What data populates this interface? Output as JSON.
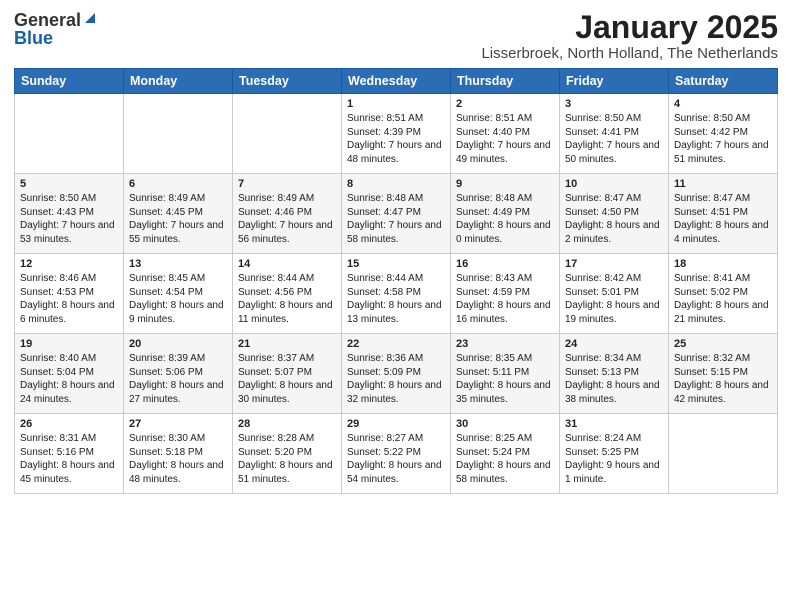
{
  "logo": {
    "general": "General",
    "blue": "Blue"
  },
  "header": {
    "month": "January 2025",
    "location": "Lisserbroek, North Holland, The Netherlands"
  },
  "weekdays": [
    "Sunday",
    "Monday",
    "Tuesday",
    "Wednesday",
    "Thursday",
    "Friday",
    "Saturday"
  ],
  "weeks": [
    [
      {
        "day": null,
        "sunrise": null,
        "sunset": null,
        "daylight": null
      },
      {
        "day": null,
        "sunrise": null,
        "sunset": null,
        "daylight": null
      },
      {
        "day": null,
        "sunrise": null,
        "sunset": null,
        "daylight": null
      },
      {
        "day": "1",
        "sunrise": "8:51 AM",
        "sunset": "4:39 PM",
        "daylight": "7 hours and 48 minutes."
      },
      {
        "day": "2",
        "sunrise": "8:51 AM",
        "sunset": "4:40 PM",
        "daylight": "7 hours and 49 minutes."
      },
      {
        "day": "3",
        "sunrise": "8:50 AM",
        "sunset": "4:41 PM",
        "daylight": "7 hours and 50 minutes."
      },
      {
        "day": "4",
        "sunrise": "8:50 AM",
        "sunset": "4:42 PM",
        "daylight": "7 hours and 51 minutes."
      }
    ],
    [
      {
        "day": "5",
        "sunrise": "8:50 AM",
        "sunset": "4:43 PM",
        "daylight": "7 hours and 53 minutes."
      },
      {
        "day": "6",
        "sunrise": "8:49 AM",
        "sunset": "4:45 PM",
        "daylight": "7 hours and 55 minutes."
      },
      {
        "day": "7",
        "sunrise": "8:49 AM",
        "sunset": "4:46 PM",
        "daylight": "7 hours and 56 minutes."
      },
      {
        "day": "8",
        "sunrise": "8:48 AM",
        "sunset": "4:47 PM",
        "daylight": "7 hours and 58 minutes."
      },
      {
        "day": "9",
        "sunrise": "8:48 AM",
        "sunset": "4:49 PM",
        "daylight": "8 hours and 0 minutes."
      },
      {
        "day": "10",
        "sunrise": "8:47 AM",
        "sunset": "4:50 PM",
        "daylight": "8 hours and 2 minutes."
      },
      {
        "day": "11",
        "sunrise": "8:47 AM",
        "sunset": "4:51 PM",
        "daylight": "8 hours and 4 minutes."
      }
    ],
    [
      {
        "day": "12",
        "sunrise": "8:46 AM",
        "sunset": "4:53 PM",
        "daylight": "8 hours and 6 minutes."
      },
      {
        "day": "13",
        "sunrise": "8:45 AM",
        "sunset": "4:54 PM",
        "daylight": "8 hours and 9 minutes."
      },
      {
        "day": "14",
        "sunrise": "8:44 AM",
        "sunset": "4:56 PM",
        "daylight": "8 hours and 11 minutes."
      },
      {
        "day": "15",
        "sunrise": "8:44 AM",
        "sunset": "4:58 PM",
        "daylight": "8 hours and 13 minutes."
      },
      {
        "day": "16",
        "sunrise": "8:43 AM",
        "sunset": "4:59 PM",
        "daylight": "8 hours and 16 minutes."
      },
      {
        "day": "17",
        "sunrise": "8:42 AM",
        "sunset": "5:01 PM",
        "daylight": "8 hours and 19 minutes."
      },
      {
        "day": "18",
        "sunrise": "8:41 AM",
        "sunset": "5:02 PM",
        "daylight": "8 hours and 21 minutes."
      }
    ],
    [
      {
        "day": "19",
        "sunrise": "8:40 AM",
        "sunset": "5:04 PM",
        "daylight": "8 hours and 24 minutes."
      },
      {
        "day": "20",
        "sunrise": "8:39 AM",
        "sunset": "5:06 PM",
        "daylight": "8 hours and 27 minutes."
      },
      {
        "day": "21",
        "sunrise": "8:37 AM",
        "sunset": "5:07 PM",
        "daylight": "8 hours and 30 minutes."
      },
      {
        "day": "22",
        "sunrise": "8:36 AM",
        "sunset": "5:09 PM",
        "daylight": "8 hours and 32 minutes."
      },
      {
        "day": "23",
        "sunrise": "8:35 AM",
        "sunset": "5:11 PM",
        "daylight": "8 hours and 35 minutes."
      },
      {
        "day": "24",
        "sunrise": "8:34 AM",
        "sunset": "5:13 PM",
        "daylight": "8 hours and 38 minutes."
      },
      {
        "day": "25",
        "sunrise": "8:32 AM",
        "sunset": "5:15 PM",
        "daylight": "8 hours and 42 minutes."
      }
    ],
    [
      {
        "day": "26",
        "sunrise": "8:31 AM",
        "sunset": "5:16 PM",
        "daylight": "8 hours and 45 minutes."
      },
      {
        "day": "27",
        "sunrise": "8:30 AM",
        "sunset": "5:18 PM",
        "daylight": "8 hours and 48 minutes."
      },
      {
        "day": "28",
        "sunrise": "8:28 AM",
        "sunset": "5:20 PM",
        "daylight": "8 hours and 51 minutes."
      },
      {
        "day": "29",
        "sunrise": "8:27 AM",
        "sunset": "5:22 PM",
        "daylight": "8 hours and 54 minutes."
      },
      {
        "day": "30",
        "sunrise": "8:25 AM",
        "sunset": "5:24 PM",
        "daylight": "8 hours and 58 minutes."
      },
      {
        "day": "31",
        "sunrise": "8:24 AM",
        "sunset": "5:25 PM",
        "daylight": "9 hours and 1 minute."
      },
      {
        "day": null,
        "sunrise": null,
        "sunset": null,
        "daylight": null
      }
    ]
  ]
}
